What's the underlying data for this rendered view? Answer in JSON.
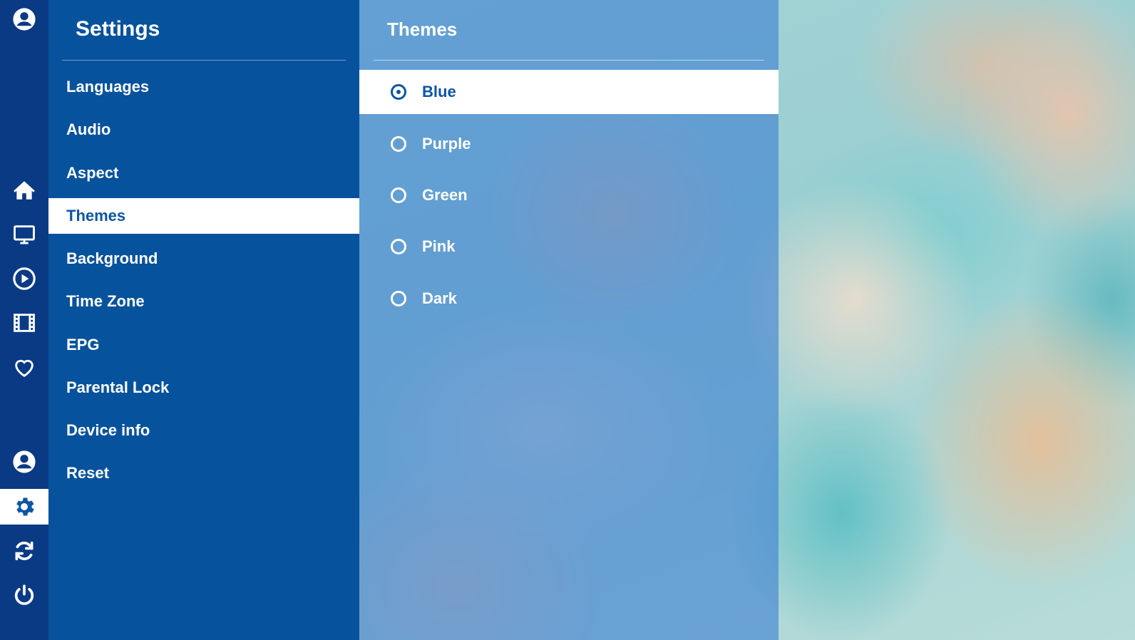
{
  "rail": {
    "top_icon": "account-icon",
    "items": [
      {
        "icon": "home-icon"
      },
      {
        "icon": "tv-icon"
      },
      {
        "icon": "play-icon"
      },
      {
        "icon": "film-icon"
      },
      {
        "icon": "heart-icon"
      },
      {
        "icon": "account-icon"
      },
      {
        "icon": "gear-icon",
        "active": true
      },
      {
        "icon": "refresh-icon"
      },
      {
        "icon": "power-icon"
      }
    ]
  },
  "settings": {
    "title": "Settings",
    "items": [
      {
        "label": "Languages"
      },
      {
        "label": "Audio"
      },
      {
        "label": "Aspect"
      },
      {
        "label": "Themes",
        "active": true
      },
      {
        "label": "Background"
      },
      {
        "label": "Time Zone"
      },
      {
        "label": "EPG"
      },
      {
        "label": "Parental Lock"
      },
      {
        "label": "Device info"
      },
      {
        "label": "Reset"
      }
    ]
  },
  "themes": {
    "title": "Themes",
    "selected": "Blue",
    "options": [
      {
        "label": "Blue"
      },
      {
        "label": "Purple"
      },
      {
        "label": "Green"
      },
      {
        "label": "Pink"
      },
      {
        "label": "Dark"
      }
    ]
  },
  "colors": {
    "rail_bg": "#0a3a84",
    "panel_bg": "#06529c",
    "accent": "#0b56a3",
    "themes_overlay": "#3e80d2"
  }
}
